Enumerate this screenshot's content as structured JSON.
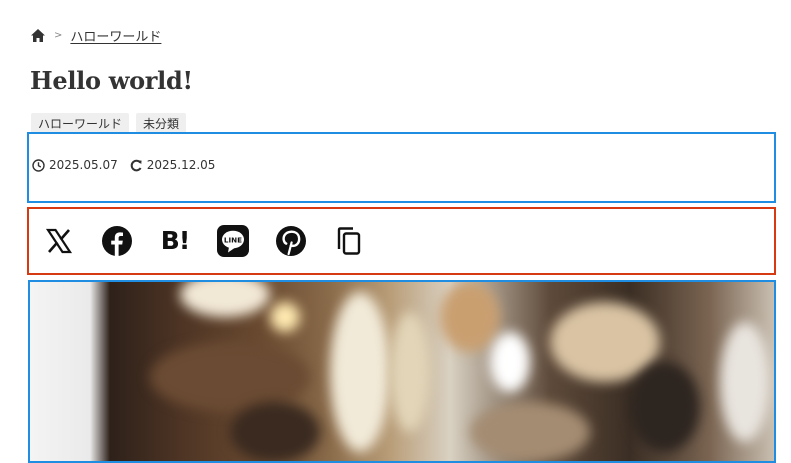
{
  "breadcrumb": {
    "home_icon": "home-icon",
    "separator": ">",
    "current": "ハローワールド"
  },
  "post": {
    "title": "Hello world!",
    "tags": [
      "ハローワールド",
      "未分類"
    ],
    "published": "2025.05.07",
    "updated": "2025.12.05"
  },
  "share_icons": [
    "x-icon",
    "facebook-icon",
    "hatena-bookmark-icon",
    "line-icon",
    "pinterest-icon",
    "copy-link-icon"
  ],
  "share": {
    "hatena_label": "B!",
    "line_label": "LINE"
  },
  "colors": {
    "outline_blue": "#1f8ee2",
    "outline_red": "#d63a13",
    "text": "#333333",
    "tag_bg": "#efefef"
  }
}
